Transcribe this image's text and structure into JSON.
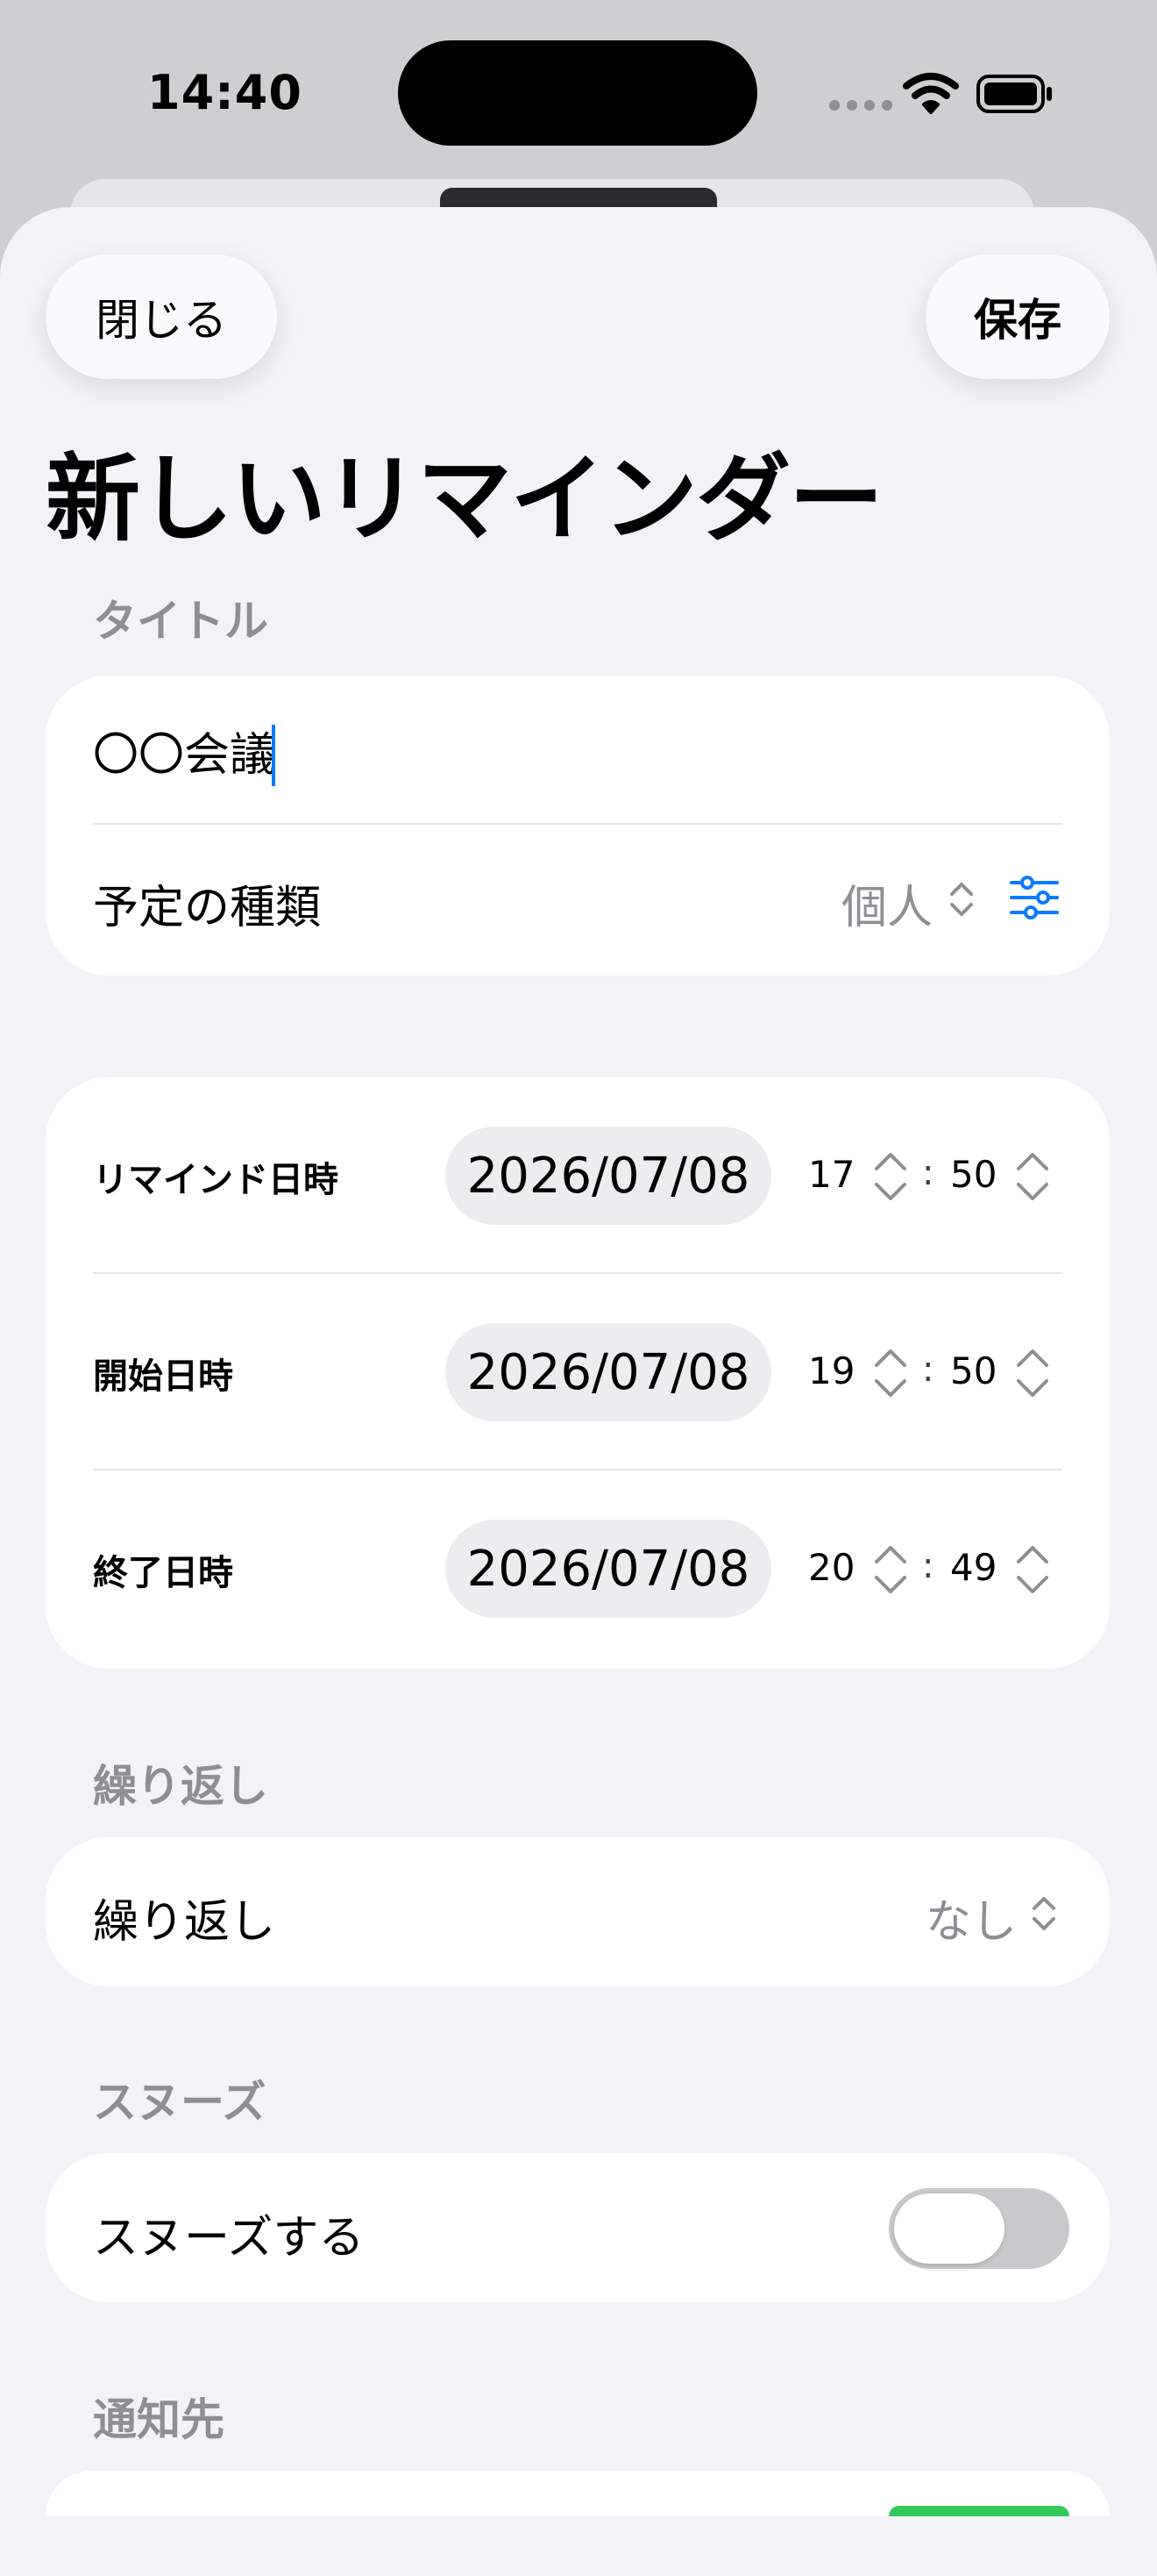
{
  "status_bar": {
    "time": "14:40"
  },
  "header": {
    "close_label": "閉じる",
    "save_label": "保存",
    "title": "新しいリマインダー"
  },
  "title_section": {
    "header": "タイトル",
    "input_value": "〇〇会議",
    "type_label": "予定の種類",
    "type_value": "個人"
  },
  "datetime_section": {
    "rows": [
      {
        "label": "リマインド日時",
        "date": "2026/07/08",
        "hour": "17",
        "minute": "50"
      },
      {
        "label": "開始日時",
        "date": "2026/07/08",
        "hour": "19",
        "minute": "50"
      },
      {
        "label": "終了日時",
        "date": "2026/07/08",
        "hour": "20",
        "minute": "49"
      }
    ],
    "colon": ":"
  },
  "repeat_section": {
    "header": "繰り返し",
    "label": "繰り返し",
    "value": "なし"
  },
  "snooze_section": {
    "header": "スヌーズ",
    "label": "スヌーズする",
    "enabled": false
  },
  "notify_section": {
    "header": "通知先"
  },
  "colors": {
    "accent": "#0a7aff",
    "toggle_on": "#34c759",
    "toggle_off": "#c9c9cc",
    "secondary_text": "#8e8e93"
  }
}
